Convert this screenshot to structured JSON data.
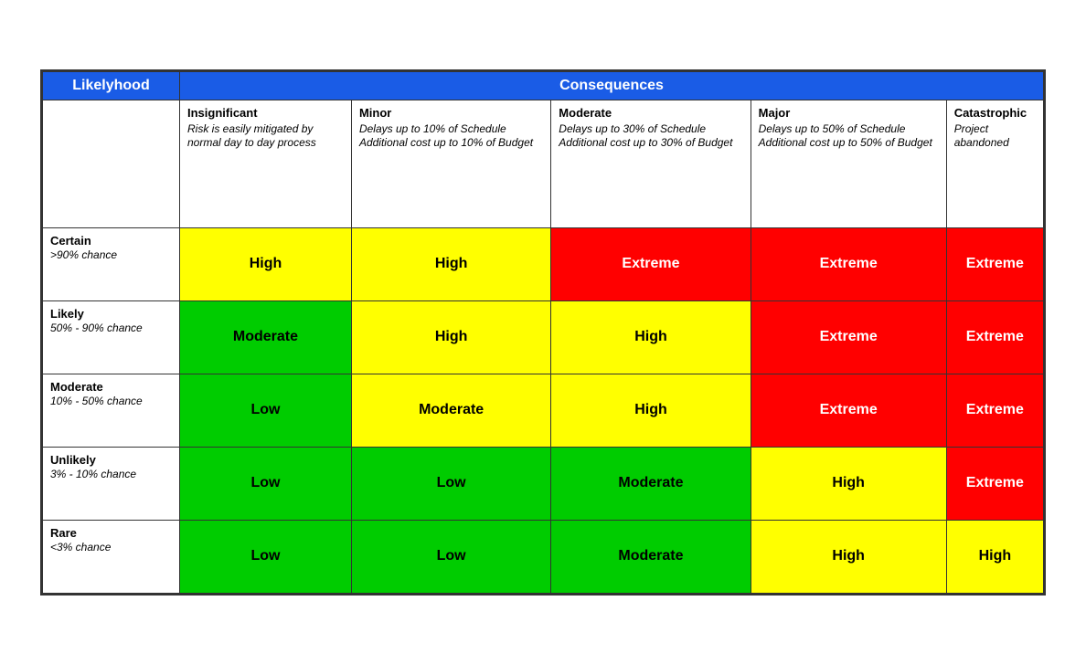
{
  "table": {
    "likelyhood_label": "Likelyhood",
    "consequences_label": "Consequences",
    "col_headers": [
      {
        "id": "insignificant",
        "title": "Insignificant",
        "desc": "Risk is easily mitigated by normal day to day process"
      },
      {
        "id": "minor",
        "title": "Minor",
        "desc": "Delays up to 10% of Schedule Additional cost up to 10% of Budget"
      },
      {
        "id": "moderate",
        "title": "Moderate",
        "desc": "Delays up to 30% of Schedule Additional cost up to 30% of Budget"
      },
      {
        "id": "major",
        "title": "Major",
        "desc": "Delays up to 50% of Schedule Additional cost up to 50% of Budget"
      },
      {
        "id": "catastrophic",
        "title": "Catastrophic",
        "desc": "Project abandoned"
      }
    ],
    "rows": [
      {
        "likelihood_title": "Certain",
        "likelihood_desc": ">90% chance",
        "cells": [
          {
            "label": "High",
            "class": "cell-high-yellow"
          },
          {
            "label": "High",
            "class": "cell-high-yellow"
          },
          {
            "label": "Extreme",
            "class": "cell-extreme"
          },
          {
            "label": "Extreme",
            "class": "cell-extreme"
          },
          {
            "label": "Extreme",
            "class": "cell-extreme"
          }
        ]
      },
      {
        "likelihood_title": "Likely",
        "likelihood_desc": "50% - 90% chance",
        "cells": [
          {
            "label": "Moderate",
            "class": "cell-high-green"
          },
          {
            "label": "High",
            "class": "cell-high-yellow"
          },
          {
            "label": "High",
            "class": "cell-high-yellow"
          },
          {
            "label": "Extreme",
            "class": "cell-extreme"
          },
          {
            "label": "Extreme",
            "class": "cell-extreme"
          }
        ]
      },
      {
        "likelihood_title": "Moderate",
        "likelihood_desc": "10% - 50% chance",
        "cells": [
          {
            "label": "Low",
            "class": "cell-high-green"
          },
          {
            "label": "Moderate",
            "class": "cell-high-yellow"
          },
          {
            "label": "High",
            "class": "cell-high-yellow"
          },
          {
            "label": "Extreme",
            "class": "cell-extreme"
          },
          {
            "label": "Extreme",
            "class": "cell-extreme"
          }
        ]
      },
      {
        "likelihood_title": "Unlikely",
        "likelihood_desc": "3% - 10% chance",
        "cells": [
          {
            "label": "Low",
            "class": "cell-high-green"
          },
          {
            "label": "Low",
            "class": "cell-high-green"
          },
          {
            "label": "Moderate",
            "class": "cell-high-green"
          },
          {
            "label": "High",
            "class": "cell-high-yellow"
          },
          {
            "label": "Extreme",
            "class": "cell-extreme"
          }
        ]
      },
      {
        "likelihood_title": "Rare",
        "likelihood_desc": "<3% chance",
        "cells": [
          {
            "label": "Low",
            "class": "cell-high-green"
          },
          {
            "label": "Low",
            "class": "cell-high-green"
          },
          {
            "label": "Moderate",
            "class": "cell-high-green"
          },
          {
            "label": "High",
            "class": "cell-high-yellow"
          },
          {
            "label": "High",
            "class": "cell-high-yellow"
          }
        ]
      }
    ]
  }
}
